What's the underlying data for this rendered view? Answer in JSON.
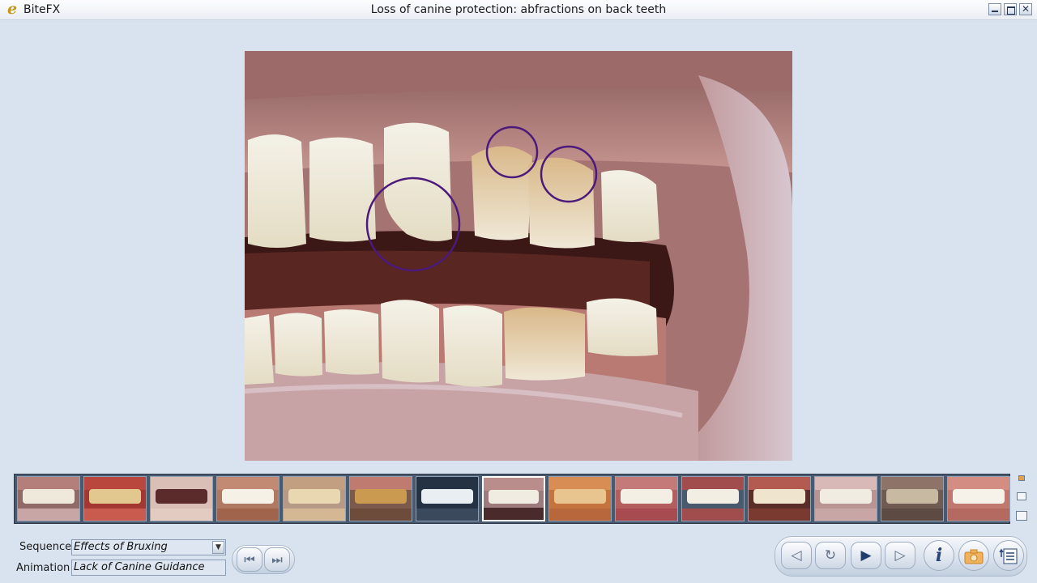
{
  "titlebar": {
    "app_icon": "e",
    "app_name": "BiteFX",
    "title": "Loss of canine protection: abfractions on back teeth",
    "controls": {
      "minimize_icon": "minimize-icon",
      "maximize_icon": "maximize-icon",
      "close_label": "✕"
    }
  },
  "thumbnails": [
    {
      "kind": "teeth-side",
      "active": false
    },
    {
      "kind": "teeth-close",
      "active": false
    },
    {
      "kind": "mouth-open",
      "active": false
    },
    {
      "kind": "smile",
      "active": false
    },
    {
      "kind": "molar-crown",
      "active": false
    },
    {
      "kind": "worn-fillings",
      "active": false
    },
    {
      "kind": "xray",
      "active": false
    },
    {
      "kind": "side-bite",
      "active": true
    },
    {
      "kind": "worn-front",
      "active": false
    },
    {
      "kind": "smile-lips",
      "active": false
    },
    {
      "kind": "two-arches",
      "active": false
    },
    {
      "kind": "front-bite",
      "active": false
    },
    {
      "kind": "upper-arch",
      "active": false
    },
    {
      "kind": "occlusal-fillings",
      "active": false
    },
    {
      "kind": "front-teeth",
      "active": false
    }
  ],
  "sequence": {
    "label": "Sequence",
    "value": "Effects of Bruxing",
    "dropdown_icon": "▼"
  },
  "animation": {
    "label": "Animation",
    "value": "Lack of Canine Guidance"
  },
  "skip_buttons": {
    "first_icon": "⏮",
    "last_icon": "⏭"
  },
  "playback": {
    "prev_icon": "◁",
    "loop_icon": "↻",
    "play_icon": "▶",
    "next_icon": "▷",
    "info_icon": "i"
  },
  "colors": {
    "circle_highlight": "#4b1a7a",
    "background": "#d9e3ef"
  }
}
